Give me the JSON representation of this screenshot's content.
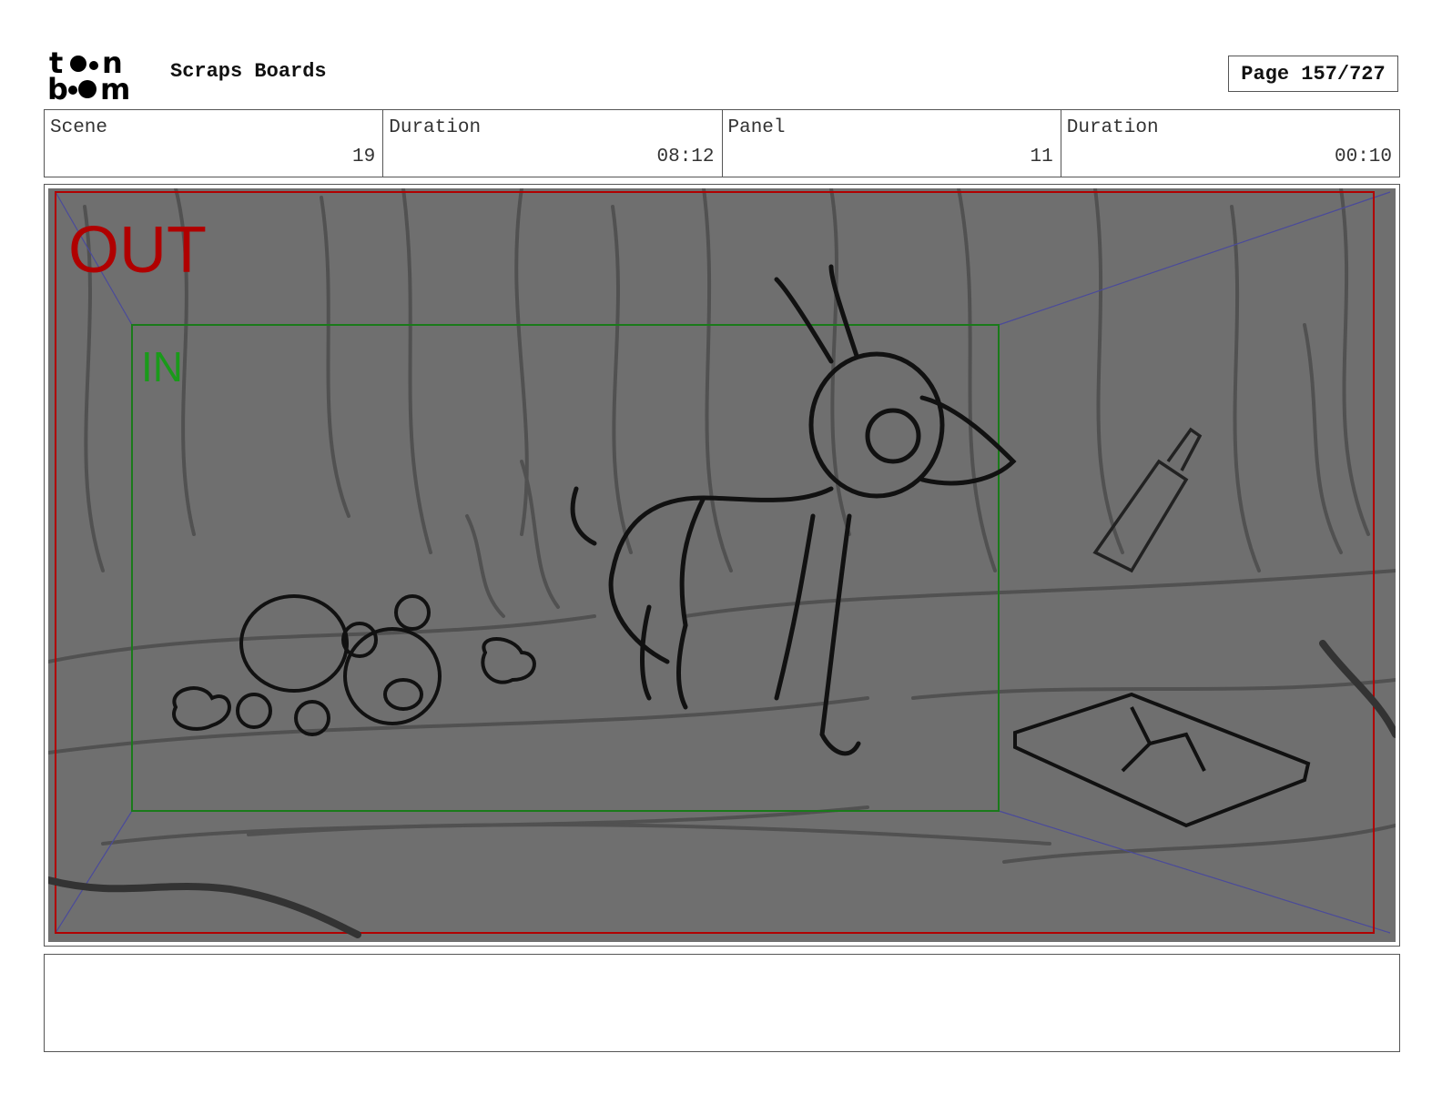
{
  "header": {
    "logo_top": "toon",
    "logo_bottom": "boom",
    "title": "Scraps Boards",
    "page_label": "Page 157/727"
  },
  "info": [
    {
      "label": "Scene",
      "value": "19"
    },
    {
      "label": "Duration",
      "value": "08:12"
    },
    {
      "label": "Panel",
      "value": "11"
    },
    {
      "label": "Duration",
      "value": "00:10"
    }
  ],
  "panel": {
    "out_label": "OUT",
    "in_label": "IN",
    "colors": {
      "out_frame": "#b00000",
      "in_frame": "#1a7a1a",
      "background": "#6f6f6f",
      "guides": "#4a4a9a"
    }
  },
  "notes": {
    "text": ""
  }
}
